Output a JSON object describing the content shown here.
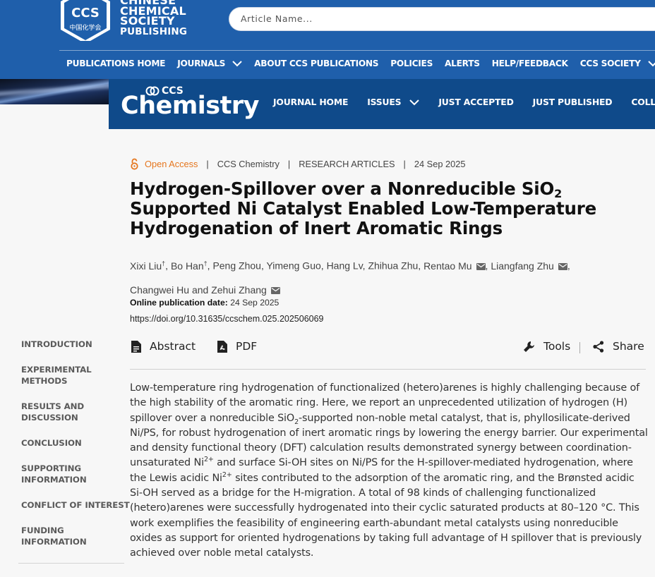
{
  "publisher": {
    "logo_text": "CCS",
    "logo_subtext": "中国化学会",
    "name_lines": [
      "CHINESE",
      "CHEMICAL",
      "SOCIETY",
      "PUBLISHING"
    ]
  },
  "search": {
    "placeholder": "Article Name..."
  },
  "top_nav": [
    {
      "label": "PUBLICATIONS HOME",
      "dropdown": false
    },
    {
      "label": "JOURNALS",
      "dropdown": true
    },
    {
      "label": "ABOUT CCS PUBLICATIONS",
      "dropdown": false
    },
    {
      "label": "POLICIES",
      "dropdown": false
    },
    {
      "label": "ALERTS",
      "dropdown": false
    },
    {
      "label": "HELP/FEEDBACK",
      "dropdown": false
    },
    {
      "label": "CCS SOCIETY",
      "dropdown": true
    }
  ],
  "journal": {
    "logo_small": "CCS",
    "logo_word": "Chemistry",
    "nav": [
      {
        "label": "JOURNAL HOME",
        "dropdown": false
      },
      {
        "label": "ISSUES",
        "dropdown": true
      },
      {
        "label": "JUST ACCEPTED",
        "dropdown": false
      },
      {
        "label": "JUST PUBLISHED",
        "dropdown": false
      },
      {
        "label": "COLLEC",
        "dropdown": false
      }
    ]
  },
  "article": {
    "access": "Open Access",
    "journal_name": "CCS Chemistry",
    "section": "RESEARCH ARTICLES",
    "date": "24 Sep 2025",
    "title_part1": "Hydrogen-Spillover over a Nonreducible SiO",
    "title_sub": "2",
    "title_part2": " Supported Ni Catalyst Enabled Low-Temperature Hydrogenation of Inert Aromatic Rings",
    "authors": [
      {
        "name": "Xixi Liu",
        "sup": "†",
        "mail": false
      },
      {
        "name": "Bo Han",
        "sup": "†",
        "mail": false
      },
      {
        "name": "Peng Zhou",
        "sup": "",
        "mail": false
      },
      {
        "name": "Yimeng Guo",
        "sup": "",
        "mail": false
      },
      {
        "name": "Hang Lv",
        "sup": "",
        "mail": false
      },
      {
        "name": "Zhihua Zhu",
        "sup": "",
        "mail": false
      },
      {
        "name": "Rentao Mu",
        "sup": "",
        "mail": true
      },
      {
        "name": "Liangfang Zhu",
        "sup": "",
        "mail": true
      },
      {
        "name": "Changwei Hu",
        "sup": "",
        "mail": false
      },
      {
        "name": "Zehui Zhang",
        "sup": "",
        "mail": true
      }
    ],
    "online_date_label": "Online publication date:",
    "online_date_value": "24 Sep 2025",
    "doi": "https://doi.org/10.31635/ccschem.025.202506069"
  },
  "sidebar": [
    {
      "label_lines": [
        "INTRODUCTION"
      ]
    },
    {
      "label_lines": [
        "EXPERIMENTAL",
        "METHODS"
      ]
    },
    {
      "label_lines": [
        "RESULTS AND",
        "DISCUSSION"
      ]
    },
    {
      "label_lines": [
        "CONCLUSION"
      ]
    },
    {
      "label_lines": [
        "SUPPORTING",
        "INFORMATION"
      ]
    },
    {
      "label_lines": [
        "CONFLICT OF INTEREST"
      ]
    },
    {
      "label_lines": [
        "FUNDING",
        "INFORMATION"
      ]
    }
  ],
  "toolbar": {
    "abstract": "Abstract",
    "pdf": "PDF",
    "tools": "Tools",
    "share": "Share"
  },
  "abstract": {
    "t1": "Low-temperature ring hydrogenation of functionalized (hetero)arenes is highly challenging because of the high stability of the aromatic ring. Here, we report an unprecedented utilization of hydrogen (H) spillover over a nonreducible SiO",
    "sub1": "2",
    "t2": "-supported non-noble metal catalyst, that is, phyllosilicate-derived Ni/PS, for robust hydrogenation of inert aromatic rings by lowering the energy barrier. Our experimental and density functional theory (DFT) calculation results demonstrated synergy between coordination-unsaturated Ni",
    "sup1": "2+",
    "t3": " and surface Si-OH sites on Ni/PS for the H-spillover-mediated hydrogenation, where the Lewis acidic Ni",
    "sup2": "2+",
    "t4": " sites contributed to the adsorption of the aromatic ring, and the Brønsted acidic Si-OH served as a bridge for the H-migration. A total of 98 kinds of challenging functionalized (hetero)arenes were successfully hydrogenated into their cyclic saturated products at 80–120 °C. This work exemplifies the feasibility of engineering earth-abundant metal catalysts using nonreducible oxides as support for oriented hydrogenations by taking full advantage of H spillover that is previously achieved over noble metal catalysts."
  },
  "colors": {
    "top_bar": "#1f5fab",
    "journal_bar": "#0f4a8a",
    "open_access": "#e5761e",
    "page_bg": "#f7f7f7"
  }
}
